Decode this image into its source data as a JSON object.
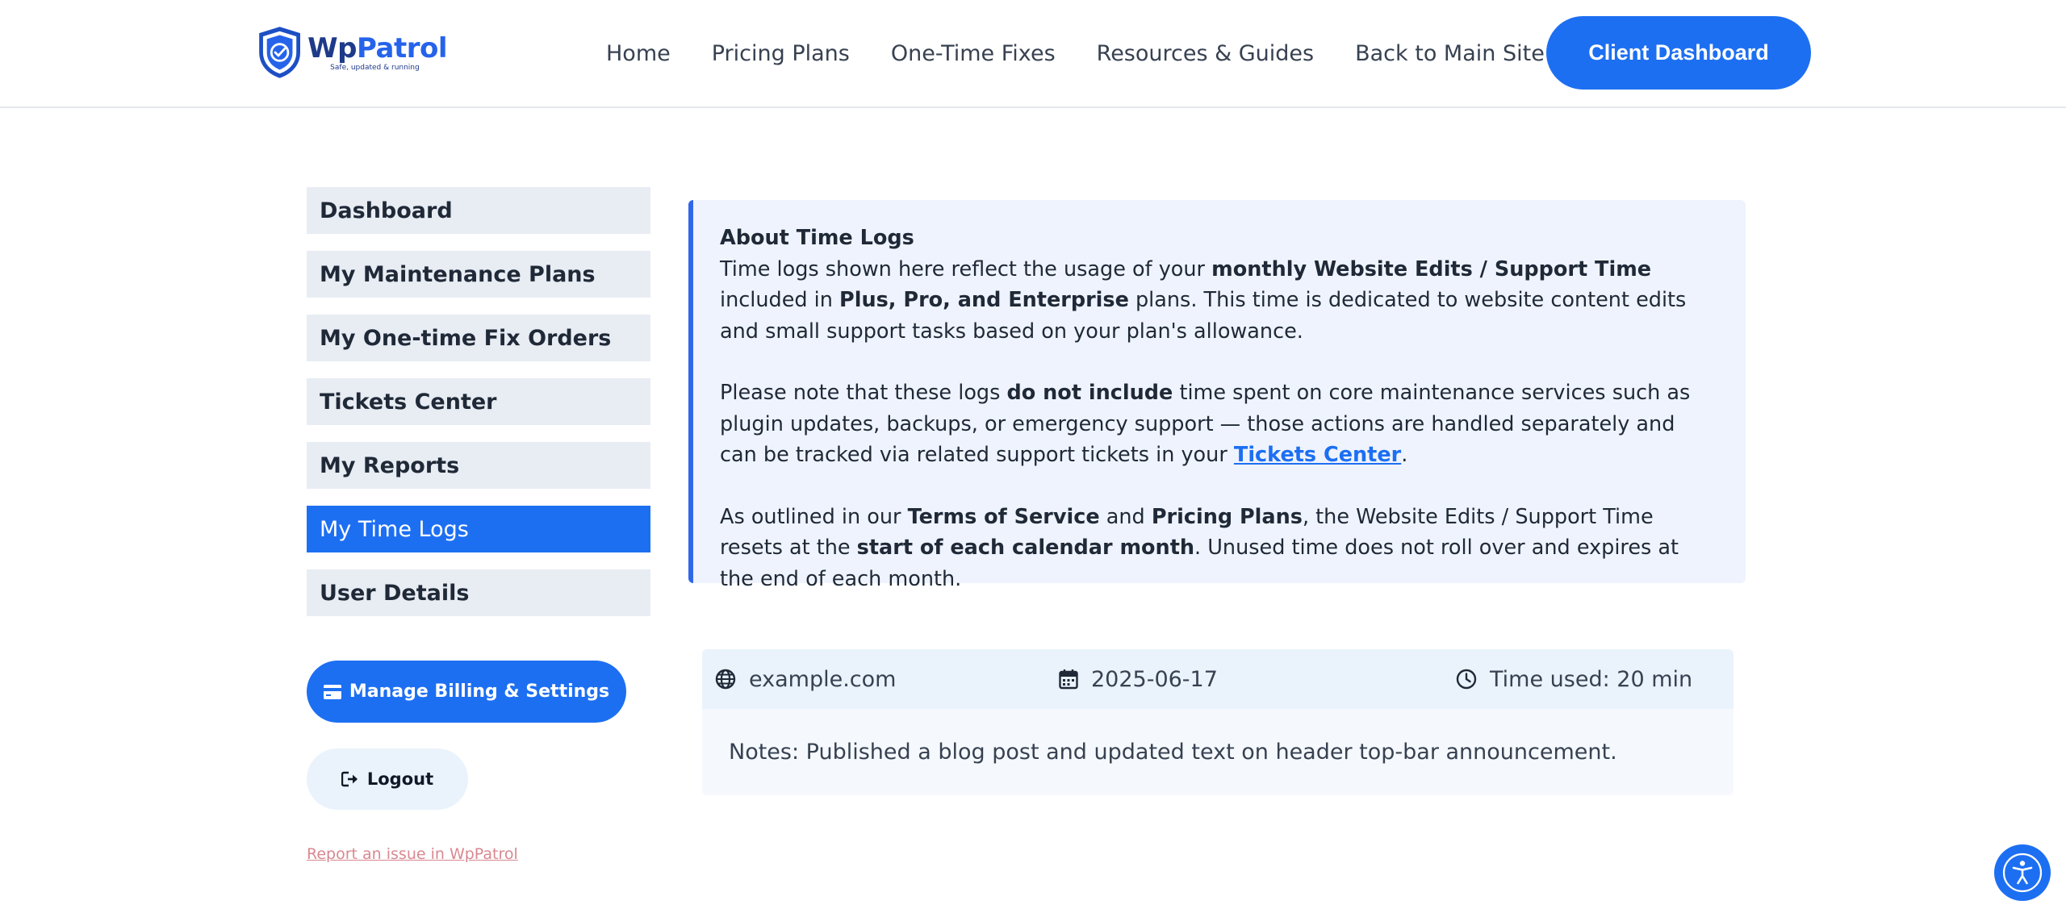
{
  "header": {
    "logo": {
      "name_part1": "Wp",
      "name_part2": "Patrol",
      "tagline": "Safe, updated & running"
    },
    "nav": [
      "Home",
      "Pricing Plans",
      "One-Time Fixes",
      "Resources & Guides",
      "Back to Main Site"
    ],
    "cta_label": "Client Dashboard"
  },
  "sidebar": {
    "items": [
      {
        "label": "Dashboard",
        "active": false
      },
      {
        "label": "My Maintenance Plans",
        "active": false
      },
      {
        "label": "My One-time Fix Orders",
        "active": false
      },
      {
        "label": "Tickets Center",
        "active": false
      },
      {
        "label": "My Reports",
        "active": false
      },
      {
        "label": "My Time Logs",
        "active": true
      },
      {
        "label": "User Details",
        "active": false
      }
    ],
    "billing_label": "Manage Billing & Settings",
    "logout_label": "Logout",
    "report_link": "Report an issue in WpPatrol"
  },
  "info": {
    "title": "About Time Logs",
    "p1": {
      "t1": "Time logs shown here reflect the usage of your ",
      "b1": "monthly Website Edits / Support Time",
      "t2": " included in ",
      "b2": "Plus, Pro, and Enterprise",
      "t3": " plans. This time is dedicated to website content edits and small support tasks based on your plan's allowance."
    },
    "p2": {
      "t1": "Please note that these logs ",
      "b1": "do not include",
      "t2": " time spent on core maintenance services such as plugin updates, backups, or emergency support — those actions are handled separately and can be tracked via related support tickets in your ",
      "link": "Tickets Center",
      "t3": "."
    },
    "p3": {
      "t1": "As outlined in our ",
      "b1": "Terms of Service",
      "t2": " and ",
      "b2": "Pricing Plans",
      "t3": ", the Website Edits / Support Time resets at the ",
      "b3": "start of each calendar month",
      "t4": ". Unused time does not roll over and expires at the end of each month."
    }
  },
  "log": {
    "site": "example.com",
    "date": "2025-06-17",
    "time_used": "Time used: 20 min",
    "notes": "Notes: Published a blog post and updated text on header top-bar announcement."
  },
  "colors": {
    "primary": "#1d6ff2",
    "sidebar_bg": "#e8ecf3",
    "info_bg": "#eff3fd",
    "info_border": "#2f67e8"
  }
}
